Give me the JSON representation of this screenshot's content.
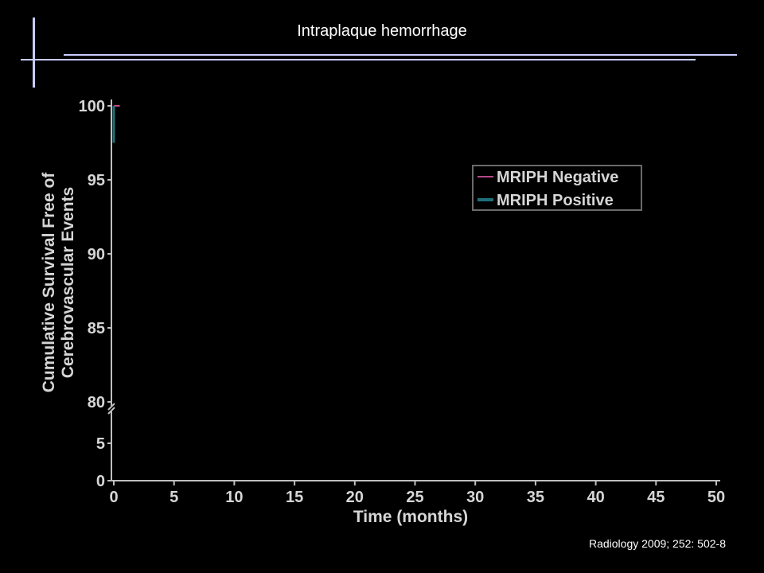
{
  "slide": {
    "title": "Intraplaque hemorrhage",
    "citation": "Radiology 2009; 252: 502-8"
  },
  "colors": {
    "background": "#000000",
    "decor_line": "#c8ccff",
    "axis": "#bfbfbf",
    "text": "#d6d6d6",
    "negative_series": "#b54a8a",
    "positive_series": "#1f6f7a"
  },
  "chart_data": {
    "type": "line",
    "step": true,
    "xlabel": "Time (months)",
    "ylabel": [
      "Cumulative Survival Free of",
      "Cerebrovascular Events"
    ],
    "xlim": [
      0,
      50
    ],
    "x_ticks": [
      "0",
      "5",
      "10",
      "15",
      "20",
      "25",
      "30",
      "35",
      "40",
      "45",
      "50"
    ],
    "y_ticks_upper": [
      "80",
      "85",
      "90",
      "95",
      "100"
    ],
    "y_ticks_lower": [
      "0",
      "5"
    ],
    "ylim_upper": [
      80,
      100
    ],
    "ylim_lower": [
      0,
      5
    ],
    "axis_break": true,
    "grid": false,
    "legend_position": "top-right",
    "series": [
      {
        "name": "MRIPH Negative",
        "color": "#b54a8a",
        "x": [
          0,
          0.5
        ],
        "y": [
          100,
          100
        ]
      },
      {
        "name": "MRIPH Positive",
        "color": "#1f6f7a",
        "x": [
          0,
          0
        ],
        "y": [
          100,
          97.5
        ]
      }
    ]
  }
}
